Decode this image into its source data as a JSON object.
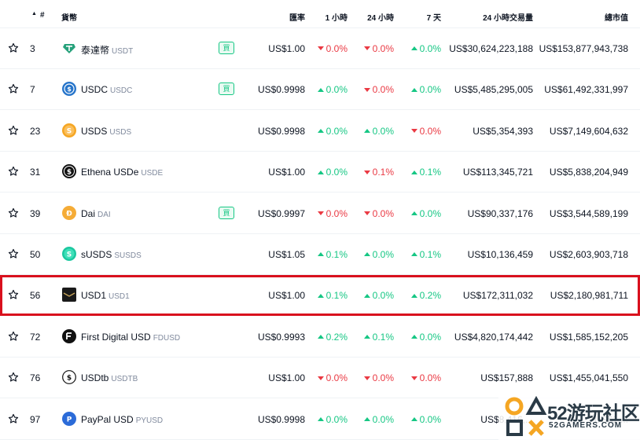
{
  "header": {
    "rank": "#",
    "coin": "貨幣",
    "price": "匯率",
    "h1": "1 小時",
    "h24": "24 小時",
    "d7": "7 天",
    "volume": "24 小時交易量",
    "mcap": "總市值"
  },
  "buy_label": "買",
  "colors": {
    "up": "#16c784",
    "down": "#ea3943",
    "highlight": "#d9101d"
  },
  "rows": [
    {
      "rank": "3",
      "name": "泰達幣",
      "symbol": "USDT",
      "buy": true,
      "price": "US$1.00",
      "h1": "0.0%",
      "h1_dir": "down",
      "h24": "0.0%",
      "h24_dir": "down",
      "d7": "0.0%",
      "d7_dir": "up",
      "volume": "US$30,624,223,188",
      "mcap": "US$153,877,943,738",
      "logo": "tether-icon",
      "logo_color": "#26a17b"
    },
    {
      "rank": "7",
      "name": "USDC",
      "symbol": "USDC",
      "buy": true,
      "price": "US$0.9998",
      "h1": "0.0%",
      "h1_dir": "up",
      "h24": "0.0%",
      "h24_dir": "down",
      "d7": "0.0%",
      "d7_dir": "up",
      "volume": "US$5,485,295,005",
      "mcap": "US$61,492,331,997",
      "logo": "usdc-icon",
      "logo_color": "#2775ca"
    },
    {
      "rank": "23",
      "name": "USDS",
      "symbol": "USDS",
      "buy": false,
      "price": "US$0.9998",
      "h1": "0.0%",
      "h1_dir": "up",
      "h24": "0.0%",
      "h24_dir": "up",
      "d7": "0.0%",
      "d7_dir": "down",
      "volume": "US$5,354,393",
      "mcap": "US$7,149,604,632",
      "logo": "usds-icon",
      "logo_color": "#f5a623"
    },
    {
      "rank": "31",
      "name": "Ethena USDe",
      "symbol": "USDE",
      "buy": false,
      "price": "US$1.00",
      "h1": "0.0%",
      "h1_dir": "up",
      "h24": "0.1%",
      "h24_dir": "down",
      "d7": "0.1%",
      "d7_dir": "up",
      "volume": "US$113,345,721",
      "mcap": "US$5,838,204,949",
      "logo": "ethena-icon",
      "logo_color": "#111111"
    },
    {
      "rank": "39",
      "name": "Dai",
      "symbol": "DAI",
      "buy": true,
      "price": "US$0.9997",
      "h1": "0.0%",
      "h1_dir": "down",
      "h24": "0.0%",
      "h24_dir": "down",
      "d7": "0.0%",
      "d7_dir": "up",
      "volume": "US$90,337,176",
      "mcap": "US$3,544,589,199",
      "logo": "dai-icon",
      "logo_color": "#f5ac37"
    },
    {
      "rank": "50",
      "name": "sUSDS",
      "symbol": "SUSDS",
      "buy": false,
      "price": "US$1.05",
      "h1": "0.1%",
      "h1_dir": "up",
      "h24": "0.0%",
      "h24_dir": "up",
      "d7": "0.1%",
      "d7_dir": "up",
      "volume": "US$10,136,459",
      "mcap": "US$2,603,903,718",
      "logo": "susds-icon",
      "logo_color": "#1cc8a0"
    },
    {
      "rank": "56",
      "name": "USD1",
      "symbol": "USD1",
      "buy": false,
      "price": "US$1.00",
      "h1": "0.1%",
      "h1_dir": "up",
      "h24": "0.0%",
      "h24_dir": "up",
      "d7": "0.2%",
      "d7_dir": "up",
      "volume": "US$172,311,032",
      "mcap": "US$2,180,981,711",
      "logo": "usd1-icon",
      "logo_color": "#1a1a1a",
      "highlight": true
    },
    {
      "rank": "72",
      "name": "First Digital USD",
      "symbol": "FDUSD",
      "buy": false,
      "price": "US$0.9993",
      "h1": "0.2%",
      "h1_dir": "up",
      "h24": "0.1%",
      "h24_dir": "up",
      "d7": "0.0%",
      "d7_dir": "up",
      "volume": "US$4,820,174,442",
      "mcap": "US$1,585,152,205",
      "logo": "fdusd-icon",
      "logo_color": "#111111"
    },
    {
      "rank": "76",
      "name": "USDtb",
      "symbol": "USDTB",
      "buy": false,
      "price": "US$1.00",
      "h1": "0.0%",
      "h1_dir": "down",
      "h24": "0.0%",
      "h24_dir": "down",
      "d7": "0.0%",
      "d7_dir": "down",
      "volume": "US$157,888",
      "mcap": "US$1,455,041,550",
      "logo": "usdtb-icon",
      "logo_color": "#ffffff"
    },
    {
      "rank": "97",
      "name": "PayPal USD",
      "symbol": "PYUSD",
      "buy": false,
      "price": "US$0.9998",
      "h1": "0.0%",
      "h1_dir": "up",
      "h24": "0.0%",
      "h24_dir": "up",
      "d7": "0.0%",
      "d7_dir": "up",
      "volume": "US$8,416,...",
      "mcap": "US$1,...",
      "logo": "paypal-icon",
      "logo_color": "#2b6bd8"
    }
  ],
  "watermark": {
    "line1": "52游玩社区",
    "line2": "52GAMERS.COM"
  }
}
